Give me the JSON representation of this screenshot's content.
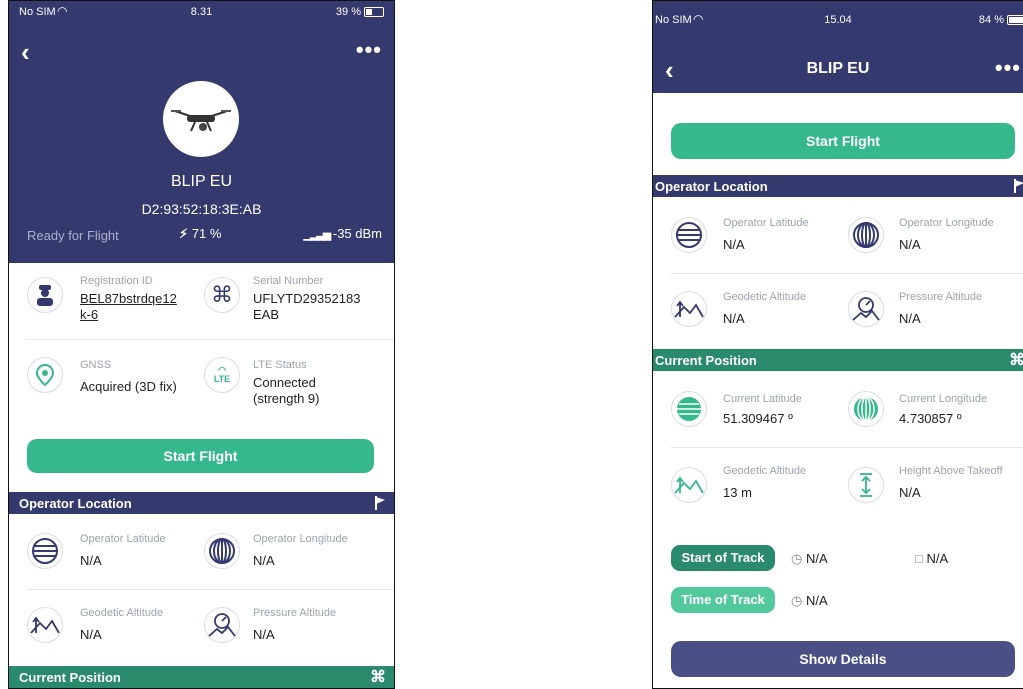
{
  "colors": {
    "navy": "#34396e",
    "green": "#35b88b",
    "teal": "#2a8a6c"
  },
  "left": {
    "status": {
      "carrier": "No SIM",
      "time": "8.31",
      "battery": "39 %"
    },
    "title": "BLIP EU",
    "mac": "D2:93:52:18:3E:AB",
    "state": "Ready for Flight",
    "battery_level": "71 %",
    "signal": "-35 dBm",
    "registration": {
      "label": "Registration ID",
      "value": "BEL87bstrdqe12k-6"
    },
    "serial": {
      "label": "Serial Number",
      "value": "UFLYTD29352183 EAB"
    },
    "gnss": {
      "label": "GNSS",
      "value": "Acquired (3D fix)"
    },
    "lte": {
      "label": "LTE Status",
      "value": "Connected (strength 9)",
      "icon_text": "LTE"
    },
    "start_flight": "Start Flight",
    "operator_section": "Operator Location",
    "op_lat": {
      "label": "Operator Latitude",
      "value": "N/A"
    },
    "op_lon": {
      "label": "Operator Longitude",
      "value": "N/A"
    },
    "geo_alt": {
      "label": "Geodetic Altitude",
      "value": "N/A"
    },
    "press_alt": {
      "label": "Pressure Altitude",
      "value": "N/A"
    },
    "current_section": "Current Position"
  },
  "right": {
    "status": {
      "carrier": "No SIM",
      "time": "15.04",
      "battery": "84 %"
    },
    "title": "BLIP EU",
    "start_flight": "Start Flight",
    "operator_section": "Operator Location",
    "op_lat": {
      "label": "Operator Latitude",
      "value": "N/A"
    },
    "op_lon": {
      "label": "Operator Longitude",
      "value": "N/A"
    },
    "geo_alt": {
      "label": "Geodetic Altitude",
      "value": "N/A"
    },
    "press_alt": {
      "label": "Pressure Altitude",
      "value": "N/A"
    },
    "current_section": "Current Position",
    "cur_lat": {
      "label": "Current Latitude",
      "value": "51.309467 º"
    },
    "cur_lon": {
      "label": "Current Longitude",
      "value": "4.730857 º"
    },
    "cur_geo_alt": {
      "label": "Geodetic Altitude",
      "value": "13 m"
    },
    "height_takeoff": {
      "label": "Height Above Takeoff",
      "value": "N/A"
    },
    "start_track": {
      "label": "Start of Track",
      "time": "N/A",
      "date": "N/A"
    },
    "time_track": {
      "label": "Time of Track",
      "time": "N/A"
    },
    "show_details": "Show Details"
  }
}
